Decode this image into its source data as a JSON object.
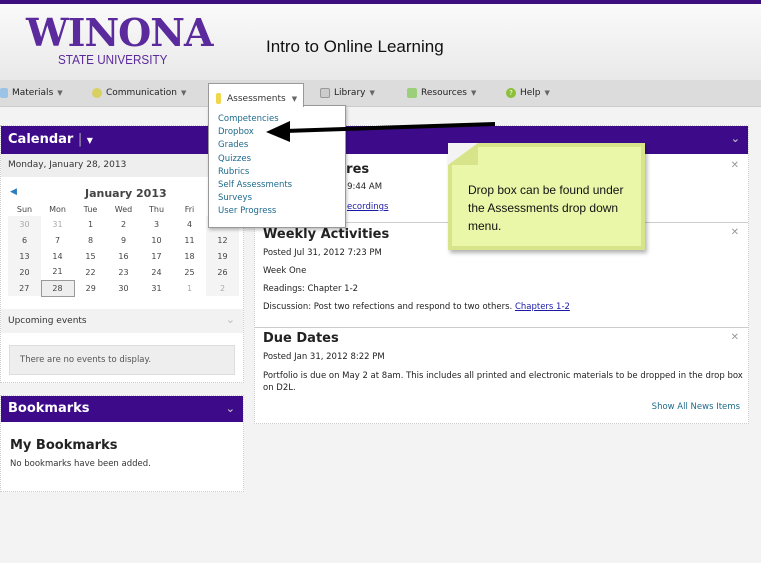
{
  "header": {
    "logo_main": "WINONA",
    "logo_sub": "STATE UNIVERSITY",
    "course_title": "Intro to Online Learning"
  },
  "nav": [
    {
      "label": "Materials",
      "icon": "book-icon"
    },
    {
      "label": "Communication",
      "icon": "chat-icon"
    },
    {
      "label": "Assessments",
      "icon": "ruler-icon"
    },
    {
      "label": "Library",
      "icon": "library-icon"
    },
    {
      "label": "Resources",
      "icon": "list-icon"
    },
    {
      "label": "Help",
      "icon": "help-icon"
    }
  ],
  "dropdown": [
    "Competencies",
    "Dropbox",
    "Grades",
    "Quizzes",
    "Rubrics",
    "Self Assessments",
    "Surveys",
    "User Progress"
  ],
  "calendar": {
    "title": "Calendar",
    "date": "Monday, January 28, 2013",
    "month": "January 2013",
    "days": [
      "Sun",
      "Mon",
      "Tue",
      "Wed",
      "Thu",
      "Fri"
    ],
    "weeks": [
      [
        "30",
        "31",
        "1",
        "2",
        "3",
        "4",
        ""
      ],
      [
        "6",
        "7",
        "8",
        "9",
        "10",
        "11",
        "12"
      ],
      [
        "13",
        "14",
        "15",
        "16",
        "17",
        "18",
        "19"
      ],
      [
        "20",
        "21",
        "22",
        "23",
        "24",
        "25",
        "26"
      ],
      [
        "27",
        "28",
        "29",
        "30",
        "31",
        "1",
        "2"
      ]
    ],
    "upcoming_label": "Upcoming events",
    "no_events": "There are no events to display."
  },
  "bookmarks": {
    "title": "Bookmarks",
    "heading": "My Bookmarks",
    "empty": "No bookmarks have been added."
  },
  "news": {
    "items": [
      {
        "title_fragment": "ctures",
        "posted_fragment": "2 9:44 AM",
        "link_fragment": "ecordings"
      },
      {
        "title": "Weekly Activities",
        "posted": "Posted Jul 31, 2012 7:23 PM",
        "lines": [
          "Week One",
          "Readings:  Chapter 1-2",
          "Discussion:  Post two refections and respond to two others."
        ],
        "link": "Chapters 1-2"
      },
      {
        "title": "Due Dates",
        "posted": "Posted Jan 31, 2012 8:22 PM",
        "lines": [
          "Portfolio is due on May 2 at 8am.   This includes all printed and electronic materials to be dropped in the drop box on D2L."
        ]
      }
    ],
    "show_all": "Show All News Items"
  },
  "note": {
    "text": "Drop box can be found under the Assessments drop down menu.",
    "color": "#eaf7a8"
  },
  "colors": {
    "brand": "#3d0b8a",
    "link": "#1e6a8c"
  }
}
